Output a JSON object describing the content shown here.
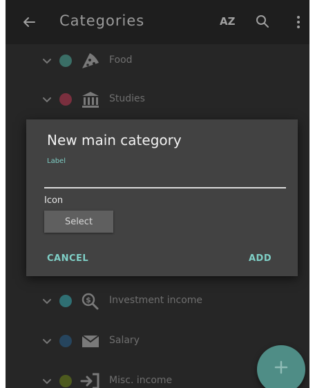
{
  "appbar": {
    "title": "Categories",
    "sort_label": "AZ",
    "icons": {
      "back": "arrow-left-icon",
      "search": "search-icon",
      "more": "more-vert-icon"
    }
  },
  "categories": [
    {
      "label": "Food",
      "dot_color": "#3a6e66",
      "icon": "pizza-icon"
    },
    {
      "label": "Studies",
      "dot_color": "#7a2f3e",
      "icon": "bank-icon"
    },
    {
      "label": "Investment income",
      "dot_color": "#2f6f73",
      "icon": "magnify-money-icon"
    },
    {
      "label": "Salary",
      "dot_color": "#26455e",
      "icon": "envelope-icon"
    },
    {
      "label": "Misc. income",
      "dot_color": "#4d5a1e",
      "icon": "login-arrow-icon"
    }
  ],
  "dialog": {
    "title": "New main category",
    "label_field": {
      "label": "Label",
      "value": "",
      "placeholder": ""
    },
    "icon_label": "Icon",
    "select_button": "Select",
    "cancel_button": "CANCEL",
    "add_button": "ADD"
  },
  "fab": {
    "icon": "plus-icon"
  },
  "colors": {
    "accent": "#7fcfc6",
    "fab": "#4f8d86",
    "dialog_bg": "#424242",
    "screen_bg": "#262626"
  }
}
